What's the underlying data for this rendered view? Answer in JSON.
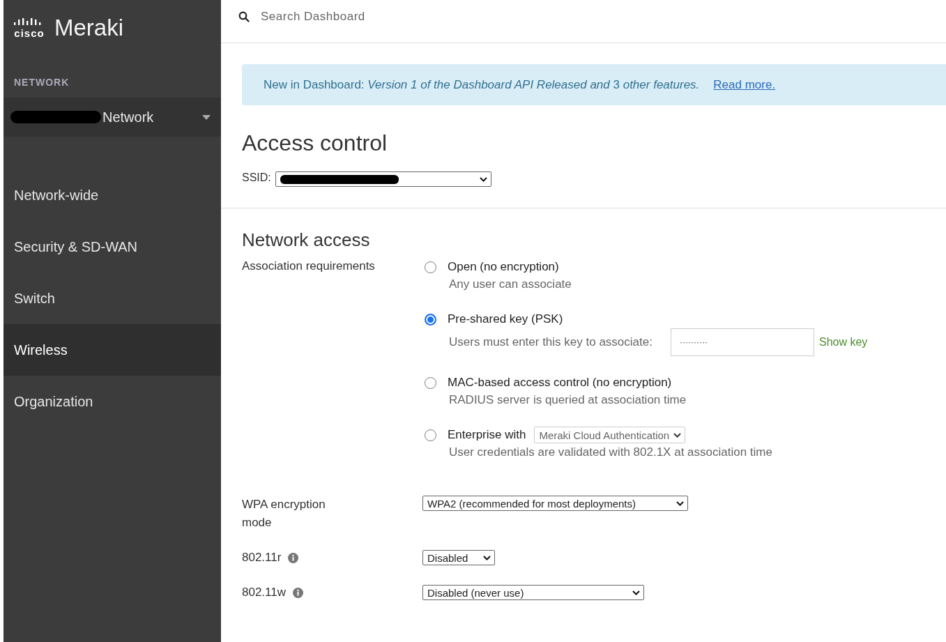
{
  "brand": {
    "company": "cisco",
    "product": "Meraki"
  },
  "sidebar": {
    "section_label": "NETWORK",
    "network_selector": {
      "name": "Network"
    },
    "items": [
      {
        "label": "Network-wide",
        "selected": false
      },
      {
        "label": "Security & SD-WAN",
        "selected": false
      },
      {
        "label": "Switch",
        "selected": false
      },
      {
        "label": "Wireless",
        "selected": true
      },
      {
        "label": "Organization",
        "selected": false
      }
    ]
  },
  "search": {
    "placeholder": "Search Dashboard"
  },
  "banner": {
    "text": "New in Dashboard: *Version 1 of the Dashboard API Released and* 3 *other features.*",
    "link": "Read more."
  },
  "page_title": "Access control",
  "ssid": {
    "label": "SSID:"
  },
  "section_title": "Network access",
  "association": {
    "label": "Association requirements",
    "options": [
      {
        "kind": "plain",
        "label": "Open (no encryption)",
        "description": "Any user can associate",
        "selected": false
      },
      {
        "kind": "key",
        "label": "Pre-shared key (PSK)",
        "description": "Users must enter this key to associate:",
        "key_value": "··········",
        "key_action": "Show key",
        "selected": true
      },
      {
        "kind": "plain",
        "label": "MAC-based access control (no encryption)",
        "description": "RADIUS server is queried at association time",
        "selected": false
      },
      {
        "kind": "dropdown",
        "label": "Enterprise with",
        "value": "Meraki Cloud Authentication",
        "description": "User credentials are validated with 802.1X at association time",
        "selected": false
      }
    ]
  },
  "settings": [
    {
      "label": "WPA encryption mode",
      "value": "WPA2 (recommended for most deployments)",
      "info": false
    },
    {
      "label": "802.11r",
      "value": "Disabled",
      "info": true
    },
    {
      "label": "802.11w",
      "value": "Disabled (never use)",
      "info": true
    }
  ]
}
